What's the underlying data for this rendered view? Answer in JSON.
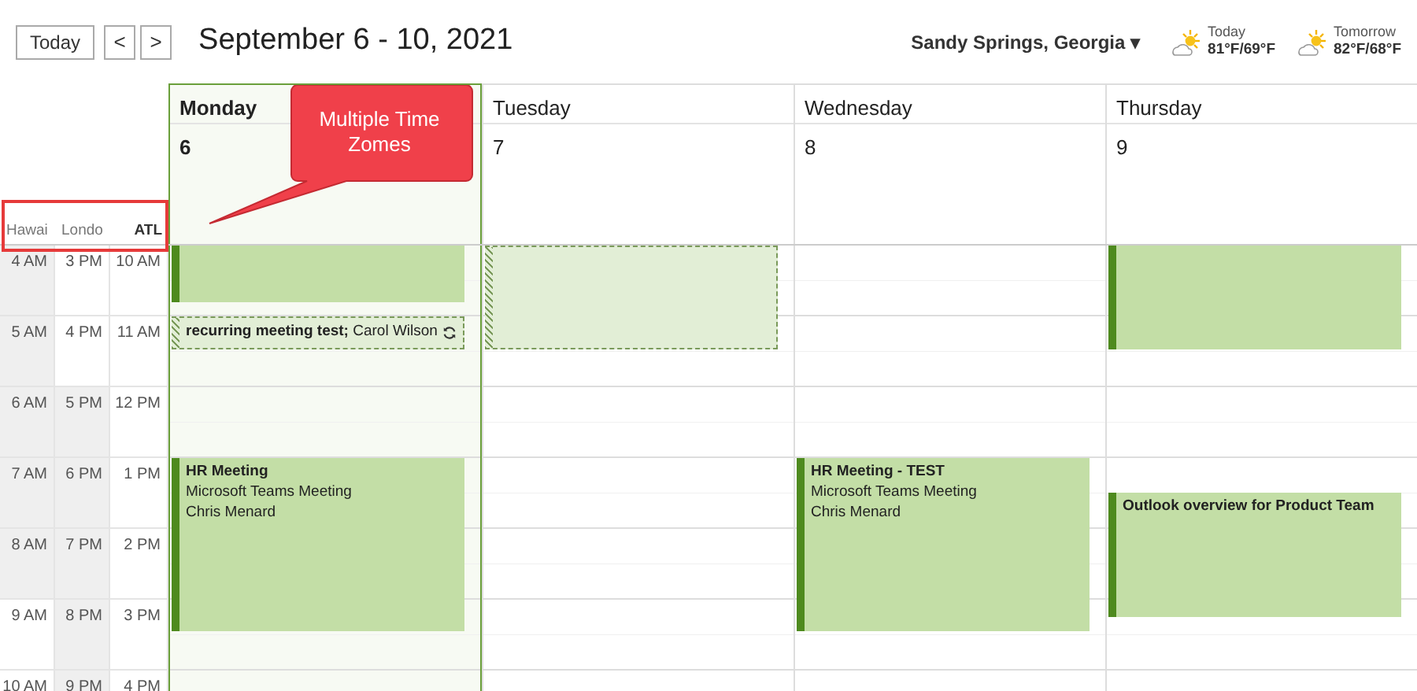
{
  "toolbar": {
    "today_button": "Today",
    "prev_button": "<",
    "next_button": ">",
    "title": "September 6 - 10, 2021",
    "location": "Sandy Springs, Georgia",
    "location_caret": "▾",
    "weather": [
      {
        "label": "Today",
        "temps": "81°F/69°F"
      },
      {
        "label": "Tomorrow",
        "temps": "82°F/68°F"
      }
    ]
  },
  "time_zones": [
    {
      "label": "Hawai",
      "primary": false
    },
    {
      "label": "Londo",
      "primary": false
    },
    {
      "label": "ATL",
      "primary": true
    }
  ],
  "time_rows": [
    [
      {
        "time": "4 AM",
        "off_hours": true
      },
      {
        "time": "3 PM",
        "off_hours": false
      },
      {
        "time": "10 AM",
        "off_hours": false
      }
    ],
    [
      {
        "time": "5 AM",
        "off_hours": true
      },
      {
        "time": "4 PM",
        "off_hours": false
      },
      {
        "time": "11 AM",
        "off_hours": false
      }
    ],
    [
      {
        "time": "6 AM",
        "off_hours": true
      },
      {
        "time": "5 PM",
        "off_hours": true
      },
      {
        "time": "12 PM",
        "off_hours": false
      }
    ],
    [
      {
        "time": "7 AM",
        "off_hours": true
      },
      {
        "time": "6 PM",
        "off_hours": true
      },
      {
        "time": "1 PM",
        "off_hours": false
      }
    ],
    [
      {
        "time": "8 AM",
        "off_hours": true
      },
      {
        "time": "7 PM",
        "off_hours": true
      },
      {
        "time": "2 PM",
        "off_hours": false
      }
    ],
    [
      {
        "time": "9 AM",
        "off_hours": false
      },
      {
        "time": "8 PM",
        "off_hours": true
      },
      {
        "time": "3 PM",
        "off_hours": false
      }
    ],
    [
      {
        "time": "10 AM",
        "off_hours": false
      },
      {
        "time": "9 PM",
        "off_hours": true
      },
      {
        "time": "4 PM",
        "off_hours": false
      }
    ]
  ],
  "days": [
    {
      "name": "Monday",
      "date": "6",
      "selected": true,
      "events": [
        {
          "kind": "busy"
        },
        {
          "kind": "tentative",
          "text": "**recurring meeting test;** Carol Wilson",
          "recurring": true
        },
        {
          "kind": "busy",
          "title": "HR Meeting",
          "lines": [
            "Microsoft Teams Meeting",
            "Chris Menard"
          ]
        }
      ]
    },
    {
      "name": "Tuesday",
      "date": "7",
      "selected": false,
      "events": [
        {
          "kind": "tentative"
        }
      ]
    },
    {
      "name": "Wednesday",
      "date": "8",
      "selected": false,
      "events": [
        {
          "kind": "busy",
          "title": "HR Meeting - TEST",
          "lines": [
            "Microsoft Teams Meeting",
            "Chris Menard"
          ]
        }
      ]
    },
    {
      "name": "Thursday",
      "date": "9",
      "selected": false,
      "events": [
        {
          "kind": "busy"
        },
        {
          "kind": "busy",
          "title": "Outlook overview for Product Team"
        }
      ]
    }
  ],
  "annotation": {
    "text": "Multiple Time Zomes"
  }
}
